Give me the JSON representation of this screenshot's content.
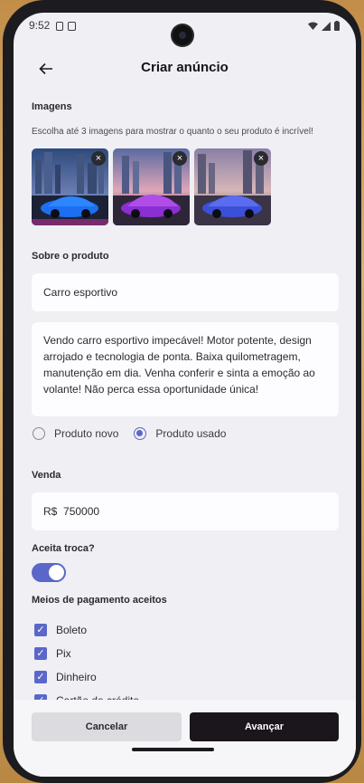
{
  "status": {
    "time": "9:52"
  },
  "header": {
    "title": "Criar anúncio"
  },
  "images": {
    "title": "Imagens",
    "hint": "Escolha até 3 imagens para mostrar o quanto o seu produto é incrível!",
    "remove_glyph": "×"
  },
  "product": {
    "title": "Sobre o produto",
    "name_value": "Carro esportivo",
    "description_value": "Vendo carro esportivo impecável! Motor potente, design arrojado e tecnologia de ponta. Baixa quilometragem, manutenção em dia. Venha conferir e sinta a emoção ao volante! Não perca essa oportunidade única!",
    "condition_options": [
      "Produto novo",
      "Produto usado"
    ],
    "selected_condition": "Produto usado"
  },
  "sale": {
    "title": "Venda",
    "currency": "R$",
    "price_value": "750000"
  },
  "trade": {
    "title": "Aceita troca?",
    "enabled": true
  },
  "payment": {
    "title": "Meios de pagamento aceitos",
    "options": [
      {
        "label": "Boleto",
        "checked": true
      },
      {
        "label": "Pix",
        "checked": true
      },
      {
        "label": "Dinheiro",
        "checked": true
      },
      {
        "label": "Cartão de crédito",
        "checked": true
      }
    ]
  },
  "actions": {
    "cancel_label": "Cancelar",
    "next_label": "Avançar"
  },
  "colors": {
    "accent": "#5b67c8",
    "primary_button": "#1a161c",
    "background": "#efeff4"
  }
}
